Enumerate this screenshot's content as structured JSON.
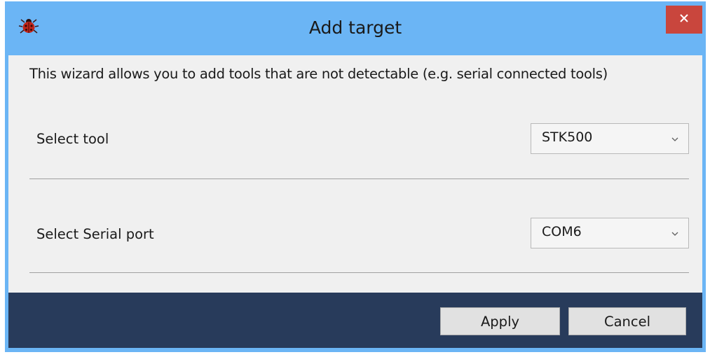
{
  "window": {
    "title": "Add target",
    "icon": "ladybug-icon",
    "close_icon": "close-icon"
  },
  "intro_text": "This wizard allows you to add tools that are not detectable (e.g. serial connected tools)",
  "tool_select": {
    "label": "Select tool",
    "value": "STK500"
  },
  "port_select": {
    "label": "Select Serial port",
    "value": "COM6"
  },
  "footer": {
    "apply_label": "Apply",
    "cancel_label": "Cancel"
  },
  "colors": {
    "title_bar": "#6bb5f5",
    "close_button": "#c9463d",
    "client_background": "#f0f0f0",
    "footer_background": "#283b5b"
  }
}
